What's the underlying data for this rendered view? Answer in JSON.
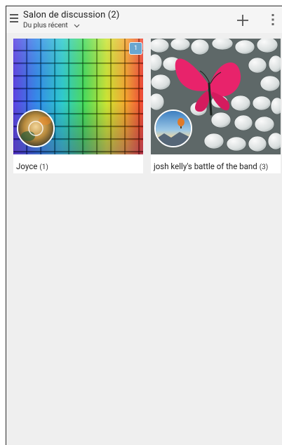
{
  "header": {
    "title": "Salon de discussion (2)",
    "sort_label": "Du plus récent"
  },
  "rooms": [
    {
      "name": "Joyce",
      "count": "(1)",
      "unread_badge": "1"
    },
    {
      "name": "josh kelly's battle of the band",
      "count": "(3)"
    }
  ],
  "colors": {
    "background": "#efefef",
    "badge": "#6aa6cf",
    "butterfly": "#e8236b"
  },
  "icons": [
    "menu-icon",
    "chevron-down-icon",
    "add-icon",
    "more-vert-icon"
  ]
}
